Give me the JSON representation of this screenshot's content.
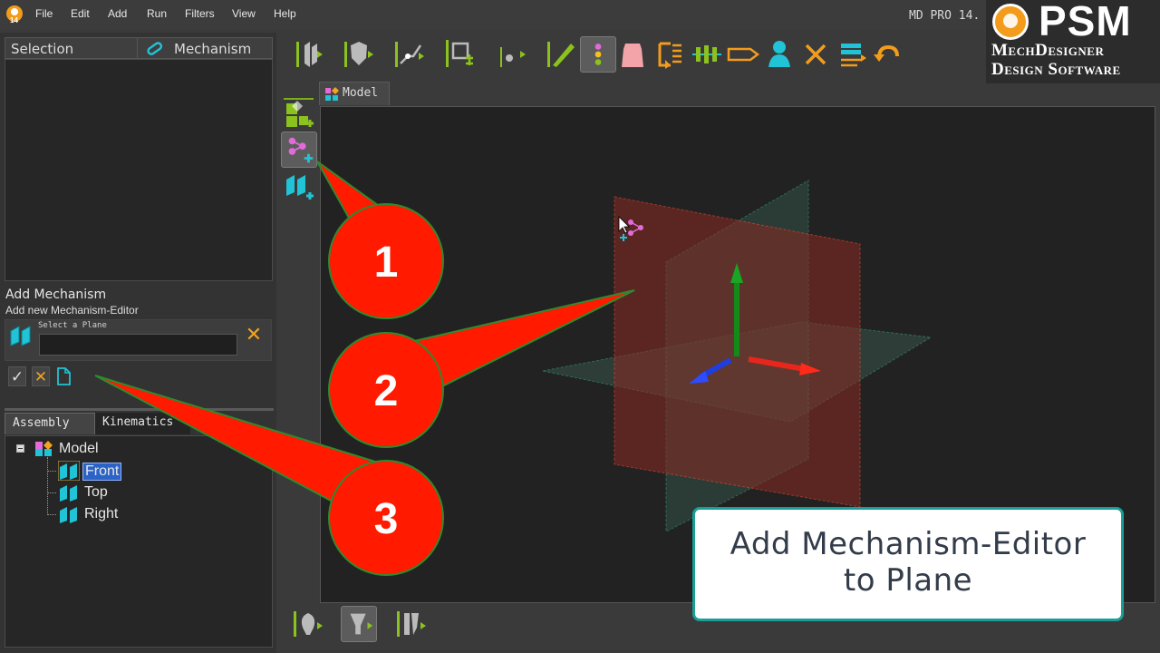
{
  "menu": [
    "File",
    "Edit",
    "Add",
    "Run",
    "Filters",
    "View",
    "Help"
  ],
  "app_version": "MD PRO 14.",
  "brand": {
    "name": "PSM",
    "line1": "MechDesigner",
    "line2": "Design Software"
  },
  "selection_panel": {
    "tab1": "Selection",
    "tab2": "Mechanism"
  },
  "add_mechanism": {
    "title": "Add Mechanism",
    "subtitle": "Add new Mechanism-Editor",
    "plane_label": "Select a Plane",
    "plane_value": ""
  },
  "tree_tabs": {
    "assembly": "Assembly",
    "kinematics": "Kinematics"
  },
  "tree": {
    "root": "Model",
    "items": [
      "Front",
      "Top",
      "Right"
    ]
  },
  "viewport_tab": "Model",
  "callouts": [
    "1",
    "2",
    "3"
  ],
  "caption": {
    "line1": "Add Mechanism-Editor",
    "line2": "to Plane"
  },
  "colors": {
    "accent_green": "#8cc21d",
    "orange": "#f39c1c",
    "callout_red": "#ff1a00",
    "caption_border": "#1a9f98"
  }
}
